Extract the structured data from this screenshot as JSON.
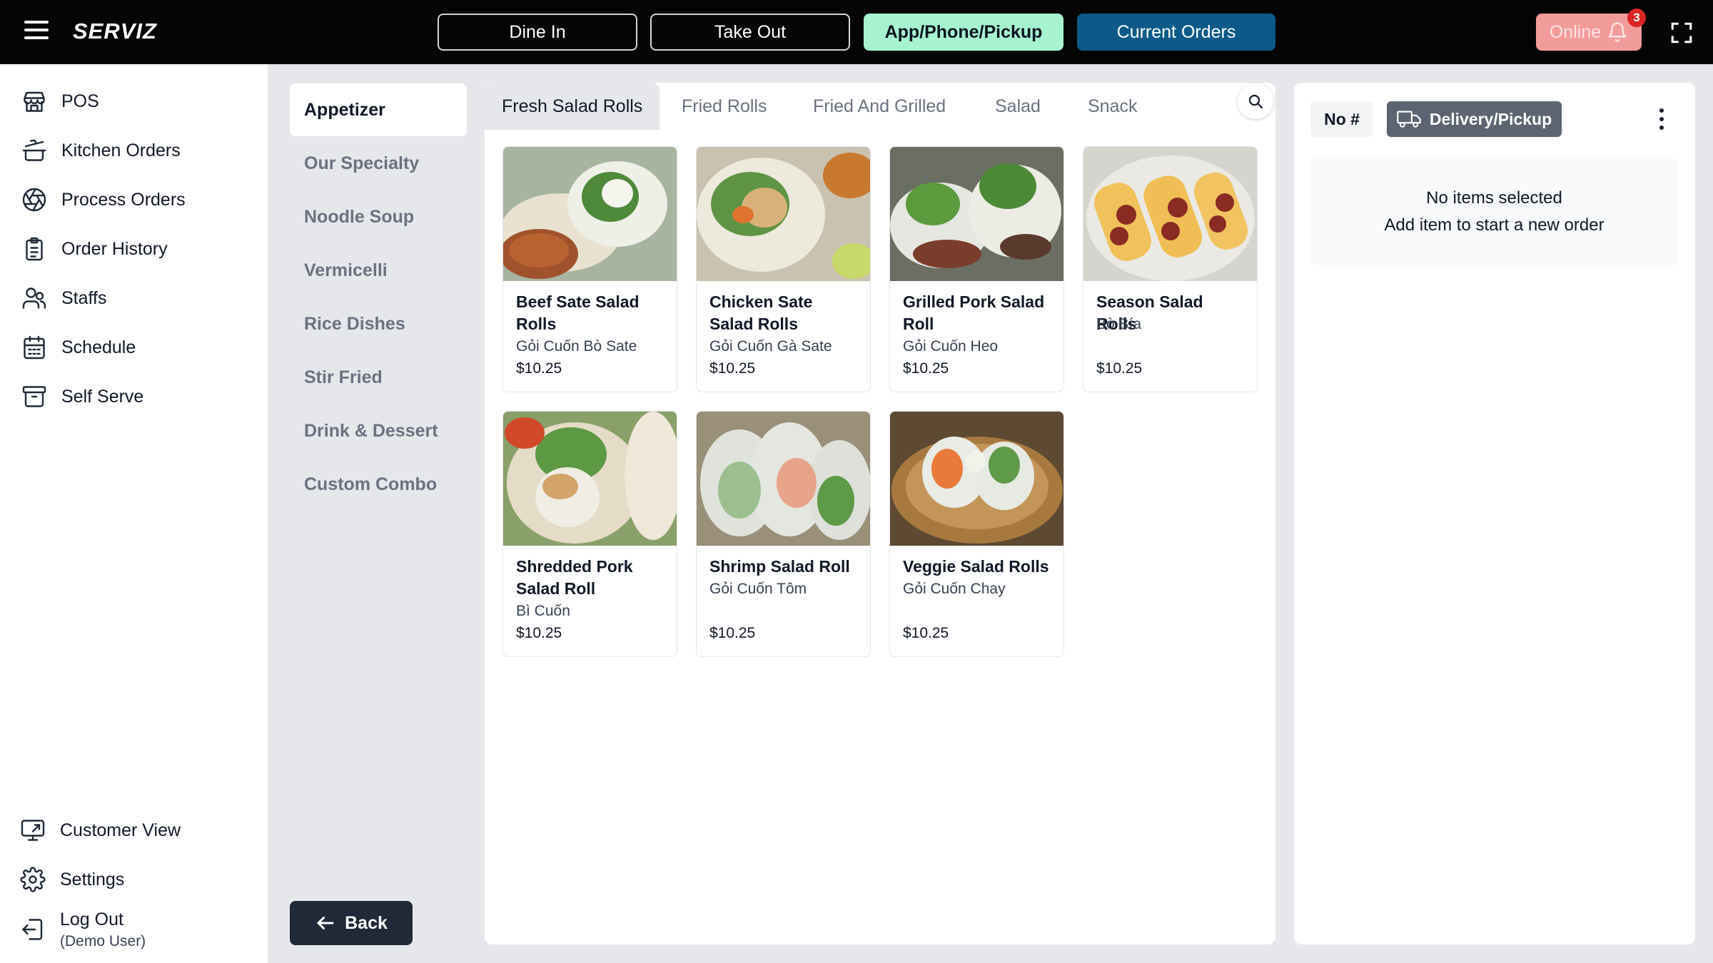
{
  "header": {
    "brand": "SERVIZ",
    "modes": {
      "dine_in": "Dine In",
      "take_out": "Take Out",
      "app_pickup": "App/Phone/Pickup",
      "current_orders": "Current Orders"
    },
    "online_label": "Online",
    "notification_count": "3",
    "accent_colors": {
      "active_mode": "#a7f3d0",
      "current_orders": "#0d5a88",
      "online": "#f29b9b"
    }
  },
  "sidebar": {
    "items": [
      {
        "label": "POS",
        "icon": "store-icon"
      },
      {
        "label": "Kitchen Orders",
        "icon": "cooking-pot-icon"
      },
      {
        "label": "Process Orders",
        "icon": "aperture-icon"
      },
      {
        "label": "Order History",
        "icon": "clipboard-list-icon"
      },
      {
        "label": "Staffs",
        "icon": "users-icon"
      },
      {
        "label": "Schedule",
        "icon": "calendar-icon"
      },
      {
        "label": "Self Serve",
        "icon": "archive-icon"
      }
    ],
    "bottom": {
      "customer_view": "Customer View",
      "settings": "Settings",
      "logout": "Log Out",
      "logout_sub": "(Demo User)"
    }
  },
  "categories": {
    "items": [
      "Appetizer",
      "Our Specialty",
      "Noodle Soup",
      "Vermicelli",
      "Rice Dishes",
      "Stir Fried",
      "Drink & Dessert",
      "Custom Combo"
    ],
    "active": "Appetizer",
    "back_label": "Back"
  },
  "subtabs": {
    "items": [
      "Fresh Salad Rolls",
      "Fried Rolls",
      "Fried And Grilled",
      "Salad",
      "Snack"
    ],
    "active": "Fresh Salad Rolls"
  },
  "products": [
    {
      "name": "Beef Sate Salad Rolls",
      "sub": "Gỏi Cuốn Bò Sate",
      "price": "$10.25"
    },
    {
      "name": "Chicken Sate Salad Rolls",
      "sub": "Gỏi Cuốn Gà Sate",
      "price": "$10.25"
    },
    {
      "name": "Grilled Pork Salad Roll",
      "sub": "Gỏi Cuốn Heo",
      "price": "$10.25"
    },
    {
      "name": "Season Salad Rolls",
      "sub": "Bò Bía",
      "price": "$10.25"
    },
    {
      "name": "Shredded Pork Salad Roll",
      "sub": "Bì Cuốn",
      "price": "$10.25"
    },
    {
      "name": "Shrimp Salad Roll",
      "sub": "Gỏi Cuốn Tôm",
      "price": "$10.25"
    },
    {
      "name": "Veggie Salad Rolls",
      "sub": "Gỏi Cuốn Chay",
      "price": "$10.25"
    }
  ],
  "order": {
    "number_label": "No #",
    "type_label": "Delivery/Pickup",
    "empty_title": "No items selected",
    "empty_hint": "Add item to start a new order"
  }
}
